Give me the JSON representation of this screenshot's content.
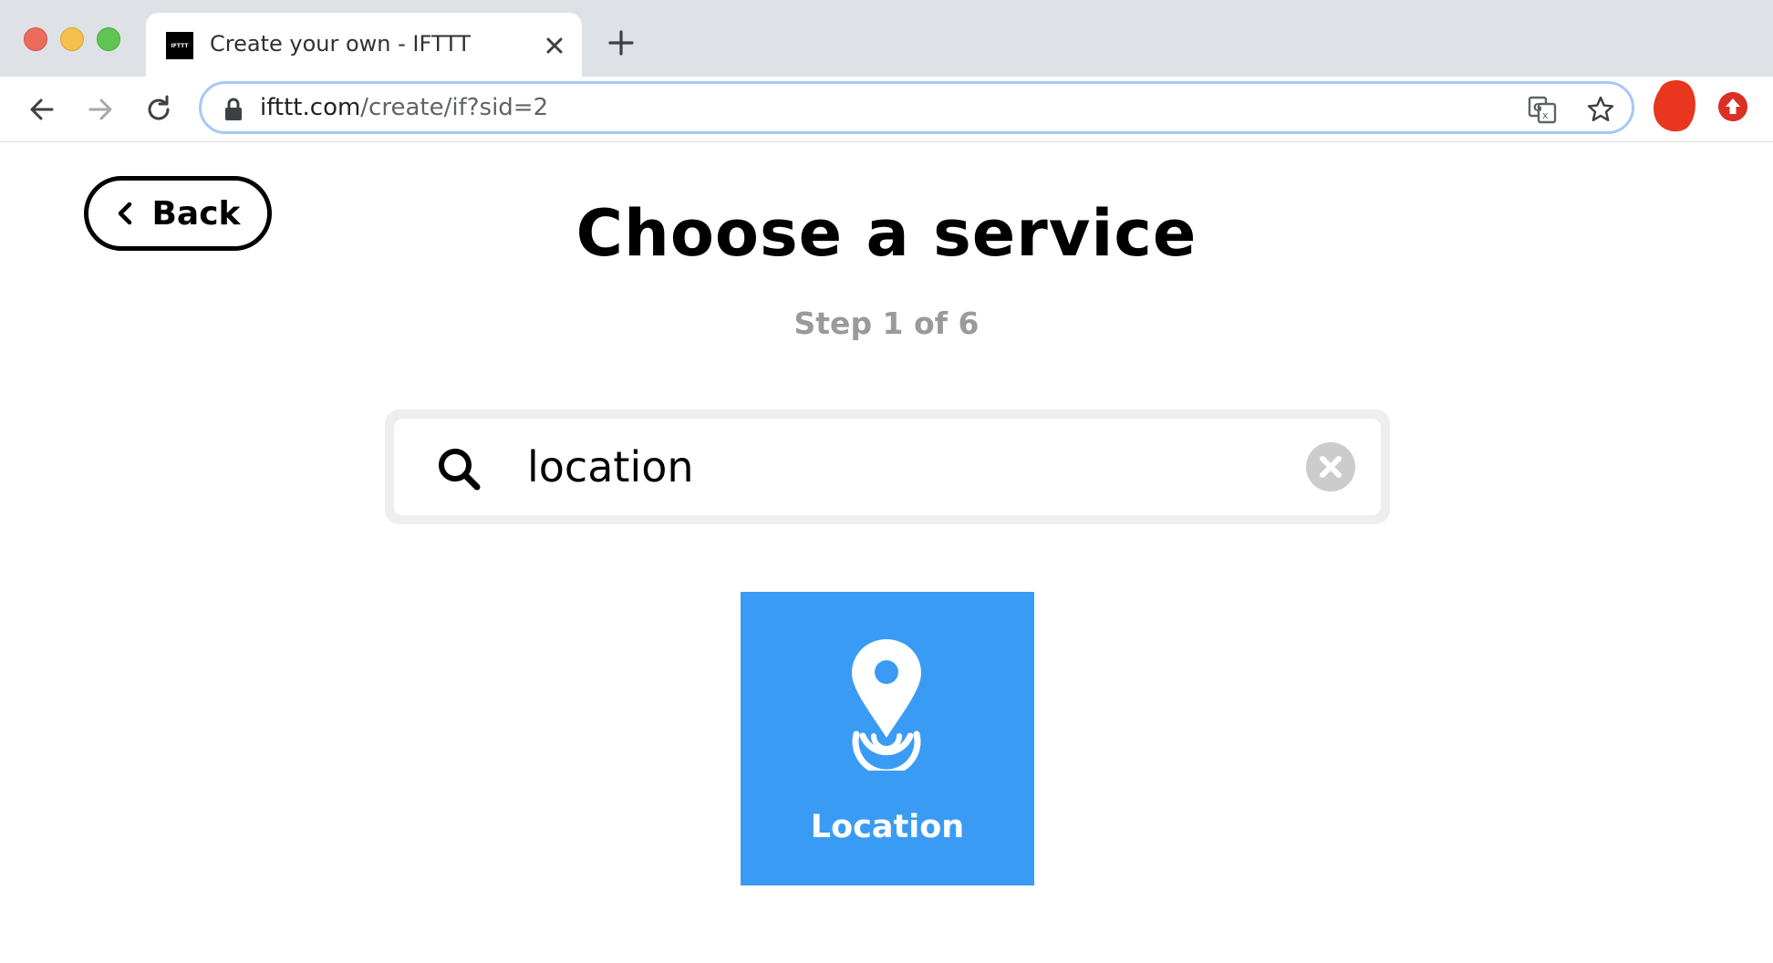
{
  "browser": {
    "tab": {
      "favicon_text": "IFTTT",
      "title": "Create your own - IFTTT"
    },
    "address_bar": {
      "domain": "ifttt.com",
      "path": "/create/if?sid=2"
    },
    "icons": {
      "back": "arrow-left-icon",
      "forward": "arrow-right-icon",
      "reload": "reload-icon",
      "lock": "lock-icon",
      "translate": "translate-icon",
      "bookmark": "star-icon",
      "close_tab": "close-icon",
      "new_tab": "plus-icon"
    }
  },
  "page": {
    "back_label": "Back",
    "title": "Choose a service",
    "step": "Step 1 of 6",
    "search": {
      "value": "location"
    },
    "services": [
      {
        "label": "Location",
        "icon": "location-pin-icon",
        "color": "#3a9bf5"
      }
    ]
  }
}
